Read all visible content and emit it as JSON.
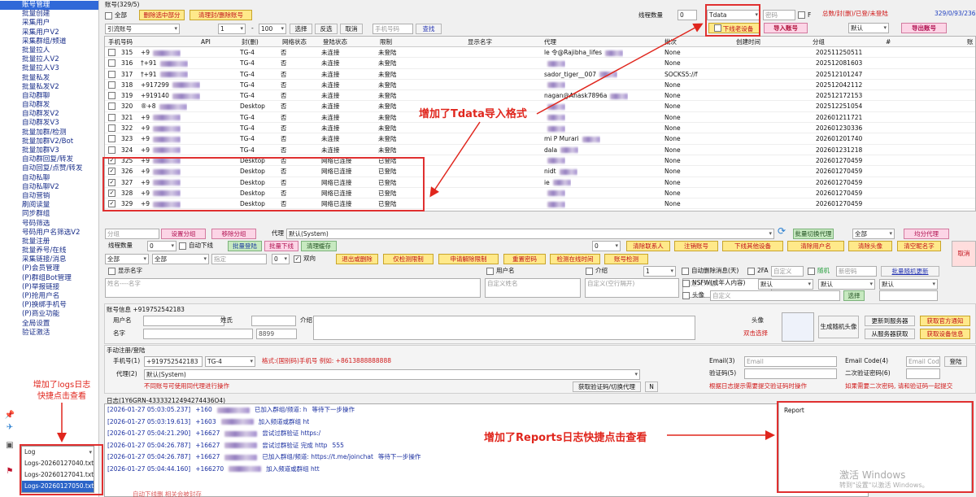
{
  "sidebar": {
    "items": [
      "账号管理",
      "批量创建",
      "采集用户",
      "采集用户V2",
      "采集群组/频道",
      "批量拉人",
      "批量拉人V2",
      "批量拉人V3",
      "批量私发",
      "批量私发V2",
      "自动群聊",
      "自动群发",
      "自动群发V2",
      "自动群发V3",
      "批量加群/检测",
      "批量加群V2/Bot",
      "批量加群V3",
      "自动群回复/转发",
      "自动回复/点赞/转发",
      "自动私聊",
      "自动私聊V2",
      "自动营销",
      "刷阅读量",
      "同步群组",
      "号码筛选",
      "号码用户名筛选V2",
      "批量注册",
      "批量养号/在线",
      "采集链接/消息",
      "(P)会员管理",
      "(P)群组Bot管理",
      "(P)举报链接",
      "(P)抢用户名",
      "(P)换绑手机号",
      "(P)商业功能",
      "全局设置",
      "验证激活"
    ],
    "logs": [
      "Log",
      "Logs-20260127040.txt",
      "Logs-20260127041.txt",
      "Logs-20260127050.txt"
    ]
  },
  "header": {
    "title": "账号(329/5)",
    "all_label": "全部",
    "delete_selected": "删除选中部分",
    "clean_banned": "清理封/删除账号",
    "thread_label": "线程数量",
    "thread_value": "0",
    "format_value": "Tdata",
    "password_ph": "密码",
    "f_label": "F",
    "stats_label": "总数/封(删)/已登/未登陆",
    "stats_value": "329/0/93/236",
    "offline_device": "下线老设备",
    "import_btn": "导入账号",
    "default_label": "默认",
    "export_btn": "导出账号"
  },
  "filter": {
    "status_ph": "引流账号",
    "from": "1",
    "to": "100",
    "select_btn": "选择",
    "invert_btn": "反选",
    "cancel_btn": "取消",
    "phone_ph": "手机号码",
    "search_btn": "查找"
  },
  "grid": {
    "columns": [
      "手机号码",
      "API",
      "封(删)",
      "网络状态",
      "登陆状态",
      "限制",
      "显示名字",
      "代理",
      "批次",
      "创建时间",
      "分组",
      "#",
      "账"
    ],
    "rows": [
      {
        "no": "315",
        "check": false,
        "phone": "+9",
        "api": "TG-4",
        "ban": "否",
        "net": "未连接",
        "login": "未登陆",
        "name": "le 令@Rajibha_lifes",
        "proxy": "None",
        "created": "202511250511"
      },
      {
        "no": "316",
        "check": false,
        "phone": "†+91",
        "api": "TG-4",
        "ban": "否",
        "net": "未连接",
        "login": "未登陆",
        "name": "",
        "proxy": "None",
        "created": "202512081603"
      },
      {
        "no": "317",
        "check": false,
        "phone": "†+91",
        "api": "TG-4",
        "ban": "否",
        "net": "未连接",
        "login": "未登陆",
        "name": "sador_tiger__007",
        "proxy": "SOCKS5://f",
        "created": "202512101247"
      },
      {
        "no": "318",
        "check": false,
        "phone": "+917299",
        "api": "TG-4",
        "ban": "否",
        "net": "未连接",
        "login": "未登陆",
        "name": "",
        "proxy": "None",
        "created": "202512042112"
      },
      {
        "no": "319",
        "check": false,
        "phone": "+919140",
        "api": "TG-4",
        "ban": "否",
        "net": "未连接",
        "login": "未登陆",
        "name": "nagan@Anask7896a",
        "proxy": "None",
        "created": "202512172153"
      },
      {
        "no": "320",
        "check": false,
        "phone": "®+8",
        "api": "Desktop",
        "ban": "否",
        "net": "未连接",
        "login": "未登陆",
        "name": "",
        "proxy": "None",
        "created": "202512251054"
      },
      {
        "no": "321",
        "check": false,
        "phone": "+9",
        "api": "TG-4",
        "ban": "否",
        "net": "未连接",
        "login": "未登陆",
        "name": "",
        "proxy": "None",
        "created": "202601211721"
      },
      {
        "no": "322",
        "check": false,
        "phone": "+9",
        "api": "TG-4",
        "ban": "否",
        "net": "未连接",
        "login": "未登陆",
        "name": "",
        "proxy": "None",
        "created": "202601230336"
      },
      {
        "no": "323",
        "check": false,
        "phone": "+9",
        "api": "TG-4",
        "ban": "否",
        "net": "未连接",
        "login": "未登陆",
        "name": "mi P Murari",
        "proxy": "None",
        "created": "202601201740"
      },
      {
        "no": "324",
        "check": false,
        "phone": "+9",
        "api": "TG-4",
        "ban": "否",
        "net": "未连接",
        "login": "未登陆",
        "name": "dala",
        "proxy": "None",
        "created": "202601231218"
      },
      {
        "no": "325",
        "check": true,
        "phone": "+9",
        "api": "Desktop",
        "ban": "否",
        "net": "网络已连接",
        "login": "已登陆",
        "name": "",
        "proxy": "None",
        "created": "202601270459"
      },
      {
        "no": "326",
        "check": true,
        "phone": "+9",
        "api": "Desktop",
        "ban": "否",
        "net": "网络已连接",
        "login": "已登陆",
        "name": "nidt",
        "proxy": "None",
        "created": "202601270459"
      },
      {
        "no": "327",
        "check": true,
        "phone": "+9",
        "api": "Desktop",
        "ban": "否",
        "net": "网络已连接",
        "login": "已登陆",
        "name": "ie",
        "proxy": "None",
        "created": "202601270459"
      },
      {
        "no": "328",
        "check": true,
        "phone": "+9",
        "api": "Desktop",
        "ban": "否",
        "net": "网络已连接",
        "login": "已登陆",
        "name": "",
        "proxy": "None",
        "created": "202601270459"
      },
      {
        "no": "329",
        "check": true,
        "phone": "+9",
        "api": "Desktop",
        "ban": "否",
        "net": "网络已连接",
        "login": "已登陆",
        "name": "",
        "proxy": "None",
        "created": "202601270459"
      }
    ]
  },
  "toolbar1": {
    "group_ph": "分组",
    "set_group": "设置分组",
    "remove_group": "移除分组",
    "proxy_label": "代理",
    "proxy_value": "默认(System)",
    "batch_switch": "批量切换代理",
    "all_label": "全部",
    "avg_proxy": "均分代理"
  },
  "toolbar2": {
    "thread_label": "线程数量",
    "thread_value": "0",
    "auto_offline": "自动下线",
    "batch_login": "批量登陆",
    "batch_offline": "批量下线",
    "clean_cache": "清理缓存",
    "count": "0",
    "clean_contacts": "清除联系人",
    "logout_acc": "注销账号",
    "offline_other": "下线其他设备",
    "clean_username": "清除用户名",
    "clean_avatar": "清除头像",
    "clean_name": "清空昵名字"
  },
  "toolbar3": {
    "all1": "全部",
    "all2": "全部",
    "mark_ph": "指定",
    "num": "0",
    "twoway": "双向",
    "exit_groups": "退出或删除",
    "limit_detect": "仅检测限制",
    "appeal": "申请解除限制",
    "reset_pwd": "重置密码",
    "detect_online": "检测在线时间",
    "acc_detect": "账号检测",
    "cancel": "取消"
  },
  "toolbar4": {
    "show_name": "显示名字",
    "username": "用户名",
    "intro": "介绍",
    "num": "1",
    "auto_delete": "自动删除消息(天)",
    "twofa": "2FA",
    "custom_ph": "自定义",
    "random": "随机",
    "new_pwd": "新密码",
    "batch_random": "批量随机更新"
  },
  "toolbar5": {
    "name_ph": "姓名----名字",
    "custom_name": "自定义姓名",
    "custom_space": "自定义(空行隔开)",
    "custom_intro": "自定义介绍",
    "nsfw": "NSFW(成年人内容)",
    "default1": "默认",
    "default2": "默认",
    "avatar": "头像",
    "custom": "自定义",
    "choose": "选择",
    "default3": "默认"
  },
  "account_info": {
    "title": "账号信息 +919752542183",
    "username": "用户名",
    "surname": "姓氏",
    "intro": "介绍",
    "first_name": "名字",
    "id_value": "8899",
    "avatar": "头像",
    "double_click": "双击选择",
    "gen_avatar": "生成随机头像",
    "update_server": "更新到服务器",
    "fetch_official": "获取官方通知",
    "fetch_server": "从服务器获取",
    "fetch_device": "获取设备信息"
  },
  "manual": {
    "title": "手动注册/登陆",
    "phone_label": "手机号(1)",
    "phone_value": "+919752542183",
    "api_value": "TG-4",
    "format_hint": "格式:(国别码)手机号 例如: +8613888888888",
    "proxy_label": "代理(2)",
    "proxy_value": "默认(System)",
    "note": "不同账号可使用同代理进行操作",
    "get_code": "获取验证码/切换代理",
    "n_btn": "N",
    "email_label": "Email(3)",
    "email_ph": "Email",
    "code_label": "验证码(5)",
    "email_code_label": "Email Code(4)",
    "email_code_ph": "Email Code",
    "login_btn": "登陆",
    "twofa_label": "二次验证密码(6)",
    "hint1": "根据日志提示需要提交验证码时操作",
    "hint2": "如果需要二次密码, 请和验证码一起提交"
  },
  "log": {
    "title": "日志(1Y6GRN-43333212494274436O4)",
    "lines": [
      {
        "time": "[2026-01-27 05:03:05.237]",
        "prefix": "+160",
        "msg": "已加入群组/频道: h",
        "tail": "等待下一步操作"
      },
      {
        "time": "[2026-01-27 05:03:19.613]",
        "prefix": "+1603",
        "msg": "加入频道或群组 ht",
        "tail": ""
      },
      {
        "time": "[2026-01-27 05:04:21.290]",
        "prefix": "+16627",
        "msg": "尝试过群验证 https:/",
        "tail": ""
      },
      {
        "time": "[2026-01-27 05:04:26.787]",
        "prefix": "+16627",
        "msg": "尝试过群验证 完成 http",
        "tail": "555"
      },
      {
        "time": "[2026-01-27 05:04:26.787]",
        "prefix": "+16627",
        "msg": "已加入群组/频道: https://t.me/joinchat",
        "tail": "等待下一步操作"
      },
      {
        "time": "[2026-01-27 05:04:44.160]",
        "prefix": "+166270",
        "msg": "加入频道或群组 htt",
        "tail": ""
      }
    ]
  },
  "report": {
    "title": "Report"
  },
  "annotations": {
    "tdata": "增加了Tdata导入格式",
    "logs": "增加了logs日志快捷点击查看",
    "reports": "增加了Reports日志快捷点击查看"
  },
  "watermark": {
    "title": "激活 Windows",
    "sub": "转到\"设置\"以激活 Windows。"
  },
  "footer": {
    "text": "自动下线删 相关会被封存"
  },
  "colors": {
    "accent": "#3069d8",
    "annotation": "#e0261d",
    "link": "#1a2fa0"
  }
}
